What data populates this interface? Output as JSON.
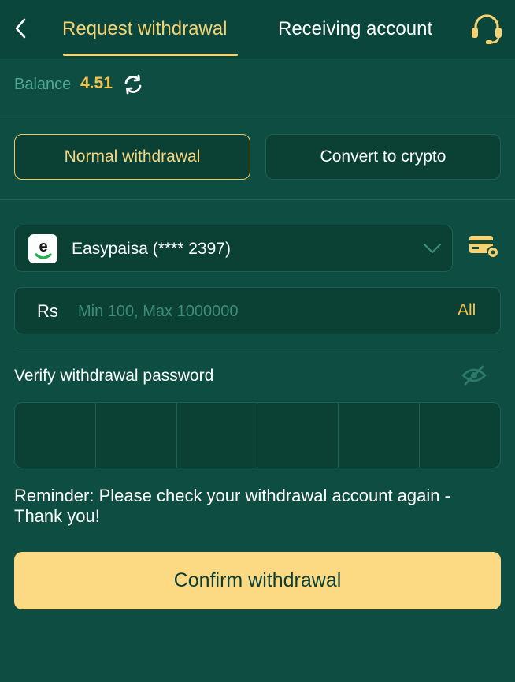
{
  "header": {
    "tabs": [
      {
        "label": "Request withdrawal",
        "active": true
      },
      {
        "label": "Receiving account",
        "active": false
      }
    ],
    "back_icon": "chevron-left-icon",
    "support_icon": "headset-icon"
  },
  "balance": {
    "label": "Balance",
    "value": "4.51",
    "refresh_icon": "refresh-icon"
  },
  "withdrawal_modes": [
    {
      "label": "Normal withdrawal",
      "selected": true
    },
    {
      "label": "Convert to crypto",
      "selected": false
    }
  ],
  "account": {
    "selected": "Easypaisa (**** 2397)",
    "logo_letter": "e",
    "dropdown_icon": "chevron-down-icon",
    "manage_icon": "card-settings-icon"
  },
  "amount": {
    "currency": "Rs",
    "placeholder": "Min 100, Max 1000000",
    "value": "",
    "all_label": "All"
  },
  "password": {
    "label": "Verify withdrawal password",
    "digits": 6,
    "visibility_icon": "eye-off-icon"
  },
  "reminder": {
    "text": "Reminder:  Please check your withdrawal account again - Thank you!"
  },
  "confirm": {
    "label": "Confirm withdrawal"
  },
  "colors": {
    "background": "#0d4d42",
    "header": "#0a463b",
    "accent_gold": "#f7d272",
    "confirm_button": "#fcd983",
    "placeholder": "#3f8c79"
  }
}
